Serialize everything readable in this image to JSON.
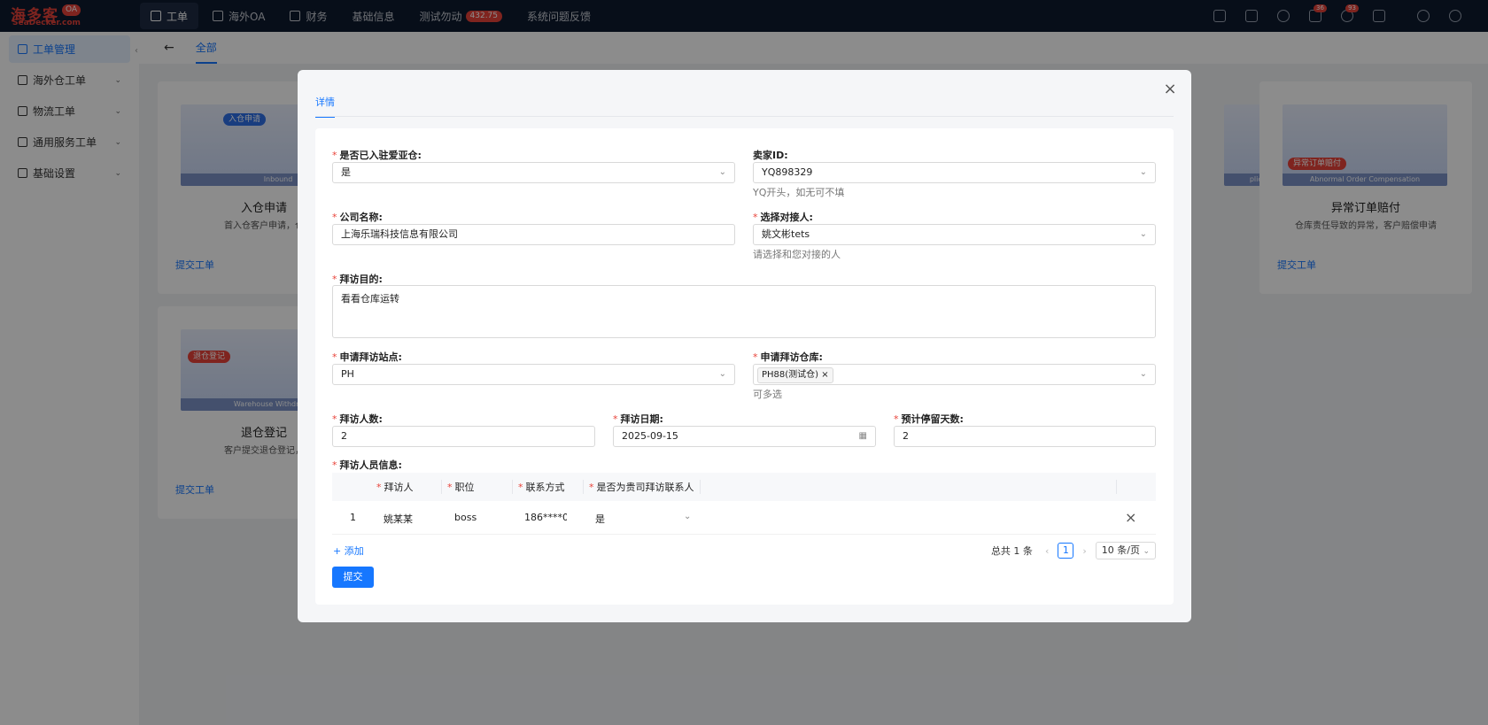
{
  "app": {
    "logo_text": "海多客",
    "logo_sub": "SeaDecker.com",
    "logo_badge": "OA"
  },
  "nav": [
    {
      "label": "工单",
      "active": true
    },
    {
      "label": "海外OA"
    },
    {
      "label": "财务"
    },
    {
      "label": "基础信息"
    },
    {
      "label": "测试勿动",
      "badge": "432.75"
    },
    {
      "label": "系统问题反馈"
    }
  ],
  "top_icons": {
    "bell_badge": "36",
    "clock_badge": "93"
  },
  "sidebar": {
    "items": [
      {
        "label": "工单管理",
        "active": true
      },
      {
        "label": "海外仓工单"
      },
      {
        "label": "物流工单"
      },
      {
        "label": "通用服务工单"
      },
      {
        "label": "基础设置"
      }
    ]
  },
  "tabs": {
    "all": "全部"
  },
  "cards": [
    {
      "title": "入仓申请",
      "desc": "首入仓客户申请，仓库评",
      "link": "提交工单",
      "img_tag": "入仓申请",
      "img_caption": "Inbound"
    },
    {
      "title": "异常订单赔付",
      "desc": "仓库责任导致的异常，客户赔偿申请",
      "link": "提交工单",
      "img_tag": "异常订单赔付",
      "img_caption": "Abnormal Order Compensation"
    },
    {
      "title": "退仓登记",
      "desc": "客户提交退仓登记，明确",
      "link": "提交工单",
      "img_tag": "退仓登记",
      "img_caption": "Warehouse Withdrawal R"
    },
    {
      "partial_desc": "申请",
      "partial_caption": "plication"
    }
  ],
  "modal": {
    "tab": "详情",
    "fields": {
      "joined_label": "是否已入驻爱亚仓:",
      "joined_value": "是",
      "seller_label": "卖家ID:",
      "seller_value": "YQ898329",
      "seller_help": "YQ开头，如无可不填",
      "company_label": "公司名称:",
      "company_value": "上海乐瑞科技信息有限公司",
      "contact_label": "选择对接人:",
      "contact_value": "姚文彬tets",
      "contact_help": "请选择和您对接的人",
      "purpose_label": "拜访目的:",
      "purpose_value": "看看仓库运转",
      "site_label": "申请拜访站点:",
      "site_value": "PH",
      "warehouse_label": "申请拜访仓库:",
      "warehouse_chip": "PH88(测试仓)",
      "warehouse_help": "可多选",
      "visitors_label": "拜访人数:",
      "visitors_value": "2",
      "date_label": "拜访日期:",
      "date_value": "2025-09-15",
      "stay_label": "预计停留天数:",
      "stay_value": "2",
      "people_label": "拜访人员信息:"
    },
    "table": {
      "headers": [
        "拜访人",
        "职位",
        "联系方式",
        "是否为贵司拜访联系人"
      ],
      "rows": [
        {
          "index": "1",
          "name": "姚某某",
          "position": "boss",
          "phone": "186****00",
          "is_contact": "是"
        }
      ]
    },
    "add_label": "添加",
    "pager": {
      "total": "总共 1 条",
      "page": "1",
      "size": "10 条/页"
    },
    "submit": "提交"
  },
  "colors": {
    "primary": "#1677ff",
    "topbar": "#0e1a2f",
    "danger": "#e8433a"
  }
}
